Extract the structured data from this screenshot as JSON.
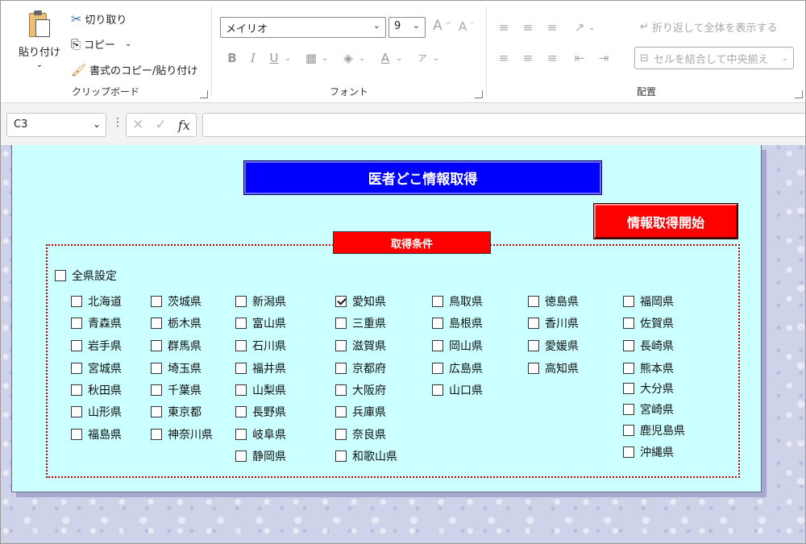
{
  "ribbon": {
    "clipboard": {
      "paste_label": "貼り付け",
      "cut_label": "切り取り",
      "copy_label": "コピー",
      "format_painter_label": "書式のコピー/貼り付け",
      "group_label": "クリップボード"
    },
    "font": {
      "font_name": "メイリオ",
      "font_size": "9",
      "grow_label": "A",
      "shrink_label": "A",
      "bold": "B",
      "italic": "I",
      "underline": "U",
      "font_color_letter": "A",
      "phonetic_glyph": "ア",
      "group_label": "フォント"
    },
    "alignment": {
      "wrap_label": "折り返して全体を表示する",
      "merge_label": "セルを結合して中央揃え",
      "group_label": "配置"
    }
  },
  "formula_bar": {
    "name_box": "C3",
    "fx_label": "fx",
    "formula": ""
  },
  "sheet": {
    "title": "医者どこ情報取得",
    "start_button": "情報取得開始",
    "conditions_label": "取得条件",
    "all_prefectures": {
      "label": "全県設定",
      "checked": false
    },
    "prefectures": [
      {
        "label": "北海道",
        "checked": false
      },
      {
        "label": "青森県",
        "checked": false
      },
      {
        "label": "岩手県",
        "checked": false
      },
      {
        "label": "宮城県",
        "checked": false
      },
      {
        "label": "秋田県",
        "checked": false
      },
      {
        "label": "山形県",
        "checked": false
      },
      {
        "label": "福島県",
        "checked": false
      },
      {
        "label": "茨城県",
        "checked": false
      },
      {
        "label": "栃木県",
        "checked": false
      },
      {
        "label": "群馬県",
        "checked": false
      },
      {
        "label": "埼玉県",
        "checked": false
      },
      {
        "label": "千葉県",
        "checked": false
      },
      {
        "label": "東京都",
        "checked": false
      },
      {
        "label": "神奈川県",
        "checked": false
      },
      {
        "label": "新潟県",
        "checked": false
      },
      {
        "label": "富山県",
        "checked": false
      },
      {
        "label": "石川県",
        "checked": false
      },
      {
        "label": "福井県",
        "checked": false
      },
      {
        "label": "山梨県",
        "checked": false
      },
      {
        "label": "長野県",
        "checked": false
      },
      {
        "label": "岐阜県",
        "checked": false
      },
      {
        "label": "静岡県",
        "checked": false
      },
      {
        "label": "愛知県",
        "checked": true
      },
      {
        "label": "三重県",
        "checked": false
      },
      {
        "label": "滋賀県",
        "checked": false
      },
      {
        "label": "京都府",
        "checked": false
      },
      {
        "label": "大阪府",
        "checked": false
      },
      {
        "label": "兵庫県",
        "checked": false
      },
      {
        "label": "奈良県",
        "checked": false
      },
      {
        "label": "和歌山県",
        "checked": false
      },
      {
        "label": "鳥取県",
        "checked": false
      },
      {
        "label": "島根県",
        "checked": false
      },
      {
        "label": "岡山県",
        "checked": false
      },
      {
        "label": "広島県",
        "checked": false
      },
      {
        "label": "山口県",
        "checked": false
      },
      {
        "label": "徳島県",
        "checked": false
      },
      {
        "label": "香川県",
        "checked": false
      },
      {
        "label": "愛媛県",
        "checked": false
      },
      {
        "label": "高知県",
        "checked": false
      },
      {
        "label": "福岡県",
        "checked": false
      },
      {
        "label": "佐賀県",
        "checked": false
      },
      {
        "label": "長崎県",
        "checked": false
      },
      {
        "label": "熊本県",
        "checked": false
      },
      {
        "label": "大分県",
        "checked": false
      },
      {
        "label": "宮崎県",
        "checked": false
      },
      {
        "label": "鹿児島県",
        "checked": false
      },
      {
        "label": "沖縄県",
        "checked": false
      }
    ]
  },
  "colors": {
    "panel_bg": "#ccffff",
    "title_bg": "#0000ff",
    "button_bg": "#ff0000",
    "frame_border": "#c00000"
  }
}
